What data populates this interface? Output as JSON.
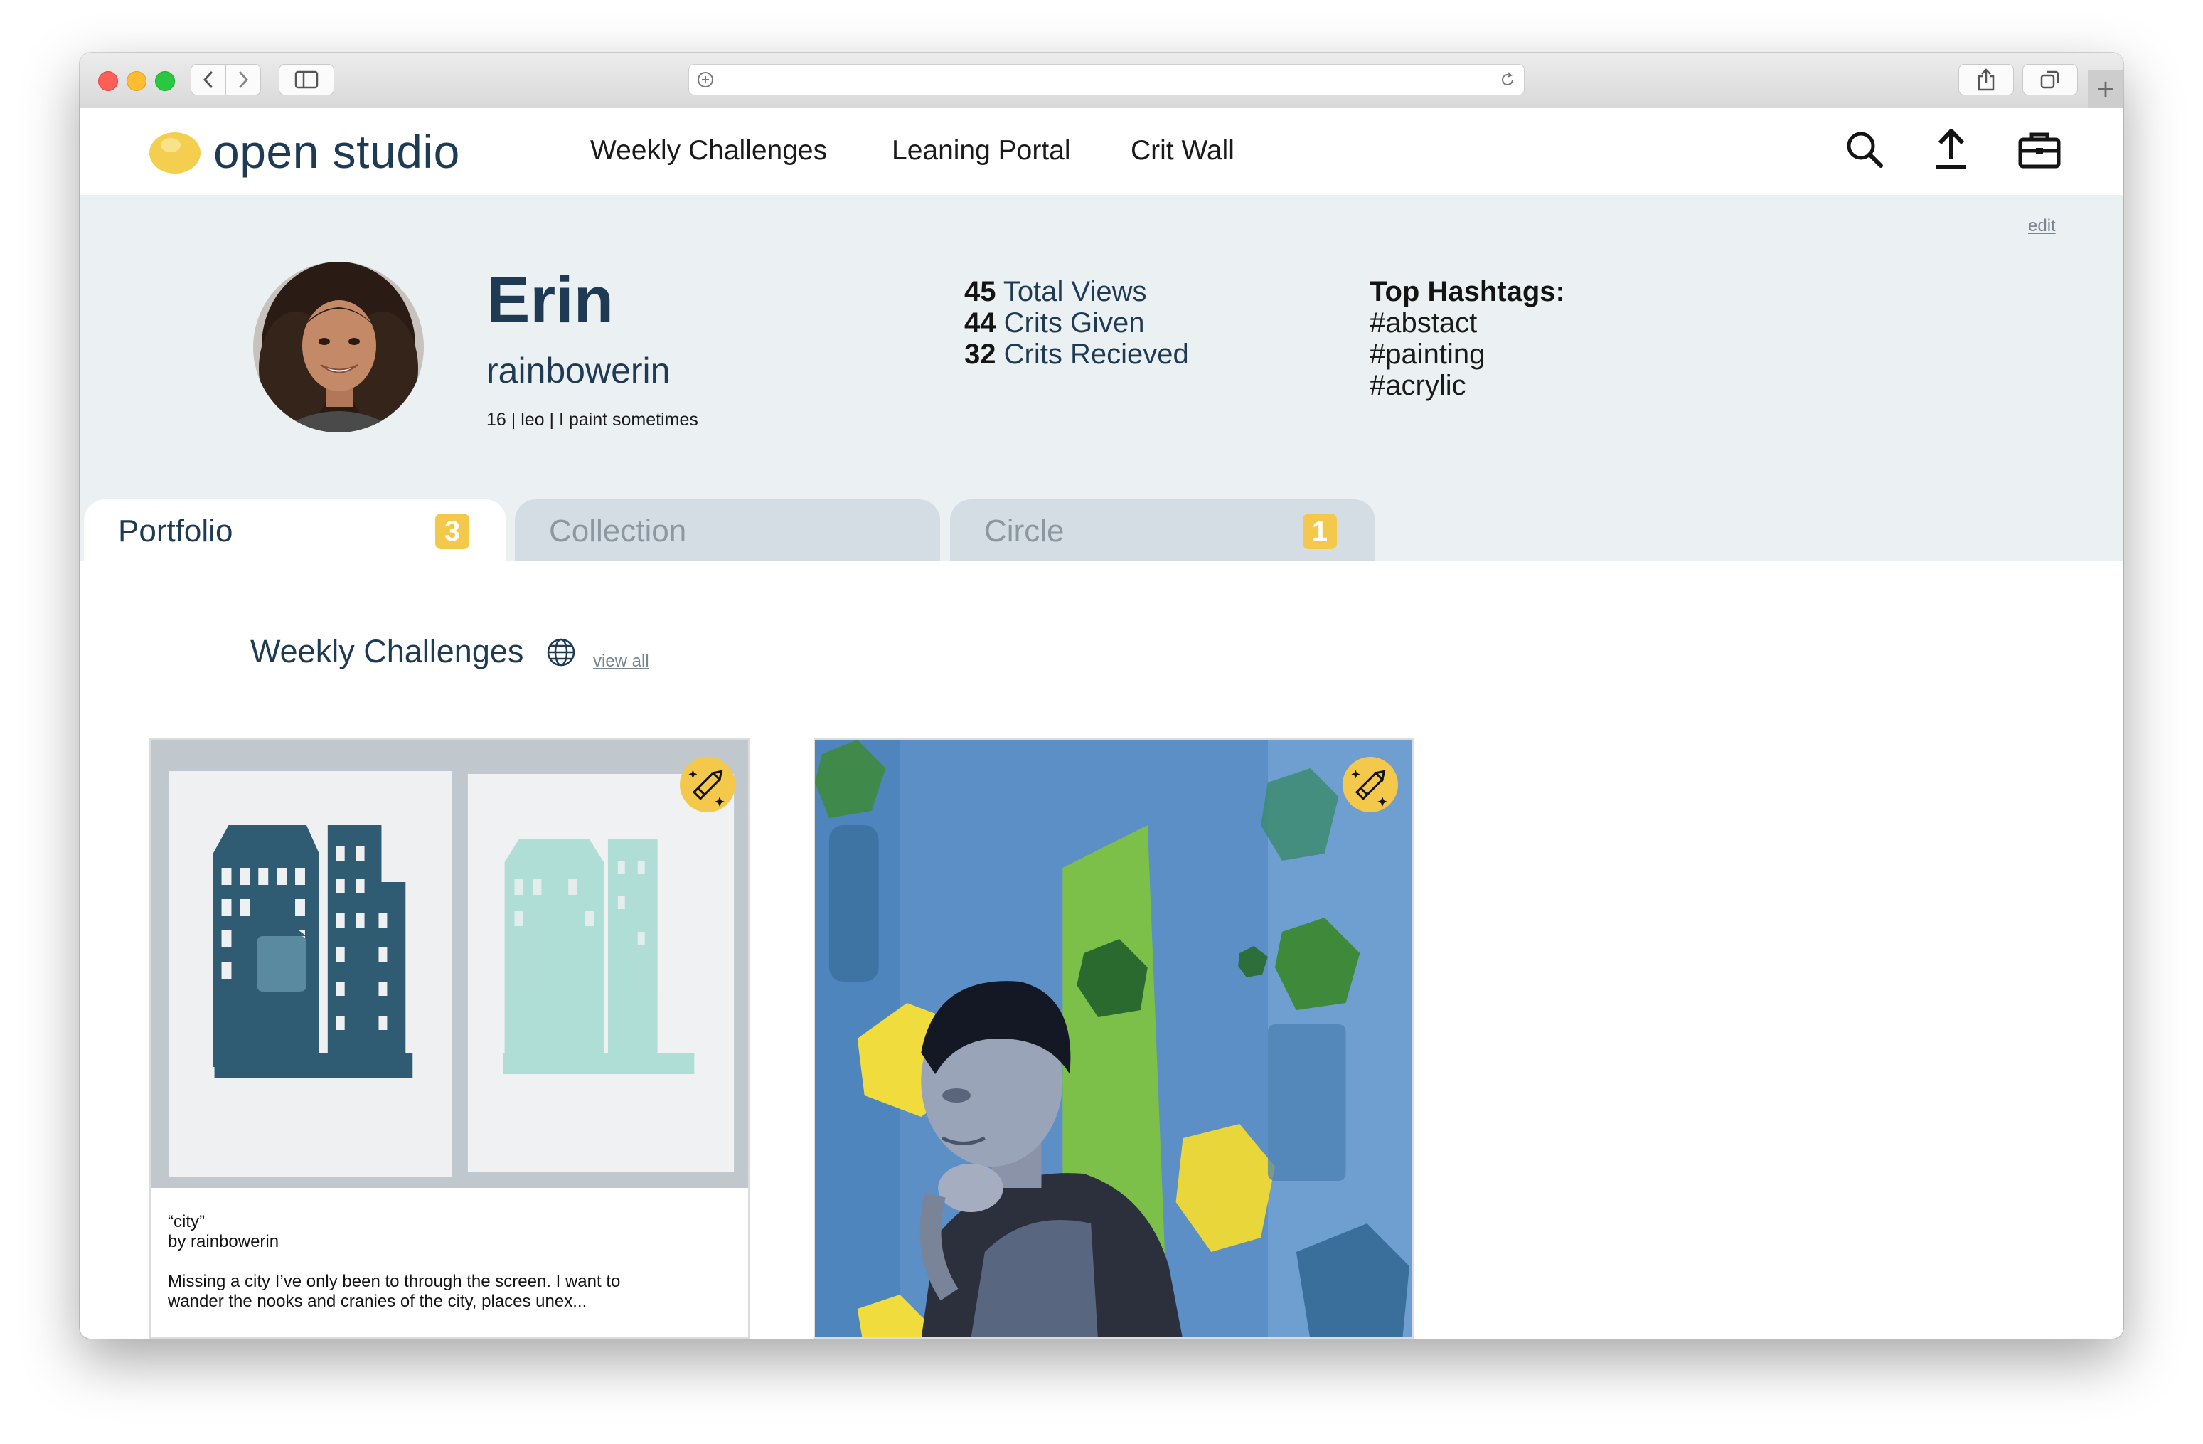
{
  "browser": {
    "window_buttons": [
      "close",
      "minimize",
      "maximize"
    ],
    "nav_icons": [
      "chevron-left-icon",
      "chevron-right-icon",
      "sidebar-icon"
    ],
    "address_icons": [
      "site-info-icon",
      "reload-icon"
    ],
    "toolbar_icons": [
      "share-icon",
      "tabs-overview-icon"
    ],
    "new_tab_label": "+"
  },
  "site": {
    "logo_text": "open studio",
    "nav_links": [
      "Weekly Challenges",
      "Leaning Portal",
      "Crit Wall"
    ],
    "nav_icons": [
      "search-icon",
      "upload-icon",
      "briefcase-icon"
    ],
    "brand_color": "#1f3b54",
    "accent_color": "#f4c84a"
  },
  "profile": {
    "edit_label": "edit",
    "name": "Erin",
    "username": "rainbowerin",
    "bio": "16  |  leo  |  I paint sometimes",
    "stats": [
      {
        "value": "45",
        "label": "Total Views"
      },
      {
        "value": "44",
        "label": "Crits Given"
      },
      {
        "value": "32",
        "label": "Crits Recieved"
      }
    ],
    "hashtags_title": "Top Hashtags:",
    "hashtags": [
      "#abstact",
      "#painting",
      "#acrylic"
    ]
  },
  "tabs": [
    {
      "label": "Portfolio",
      "badge": "3",
      "active": true
    },
    {
      "label": "Collection",
      "badge": "",
      "active": false
    },
    {
      "label": "Circle",
      "badge": "1",
      "active": false
    }
  ],
  "section": {
    "title": "Weekly Challenges",
    "view_all": "view all"
  },
  "cards": [
    {
      "title": "“city”",
      "byline": "by rainbowerin",
      "description": "Missing a city I’ve only been to through the screen. I want to wander the nooks and cranies of the city, places unex...",
      "badge_icon": "pencil-sparkle-icon"
    },
    {
      "badge_icon": "pencil-sparkle-icon"
    }
  ]
}
